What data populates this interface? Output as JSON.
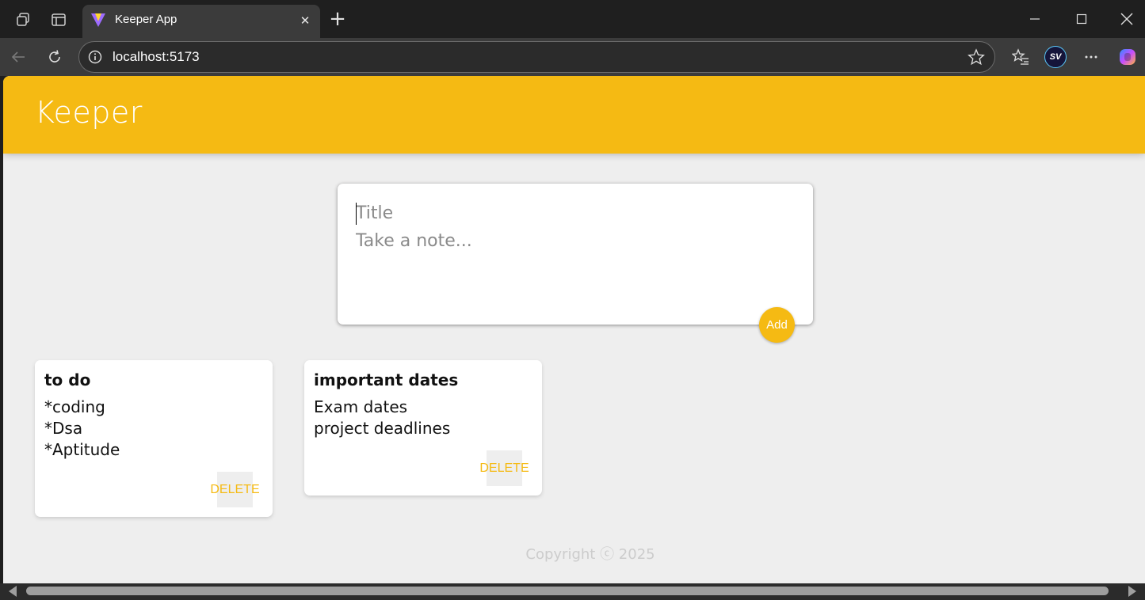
{
  "browser": {
    "tab_title": "Keeper App",
    "url": "localhost:5173",
    "new_tab_label": "+",
    "close_tab_label": "✕",
    "profile_initials": "SV"
  },
  "app": {
    "brand": "Keeper",
    "brand_color": "#f5ba13",
    "background": "#eeeeee"
  },
  "composer": {
    "title_placeholder": "Title",
    "note_placeholder": "Take a note...",
    "add_label": "Add"
  },
  "notes": [
    {
      "title": "to do",
      "lines": [
        "*coding",
        "*Dsa",
        "*Aptitude"
      ],
      "delete_label": "DELETE"
    },
    {
      "title": "important dates",
      "lines": [
        "Exam dates",
        "project deadlines"
      ],
      "delete_label": "DELETE"
    }
  ],
  "footer": {
    "copyright": "Copyright ⓒ 2025"
  }
}
